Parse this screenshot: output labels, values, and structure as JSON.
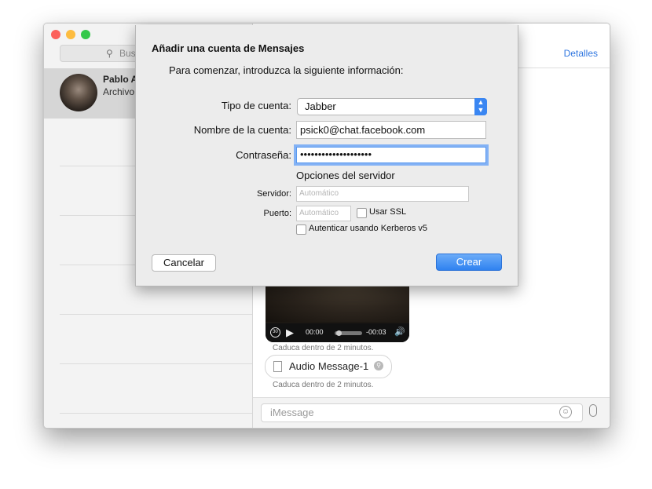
{
  "window": {
    "traffic_lights": [
      "#fc605b",
      "#fdbc40",
      "#34c84a"
    ]
  },
  "sidebar": {
    "search_placeholder": "Bus",
    "conversation": {
      "name": "Pablo A",
      "preview": "Archivo"
    }
  },
  "main": {
    "details_link": "Detalles",
    "video": {
      "skip_label": "30",
      "time_elapsed": "00:00",
      "time_remaining": "-00:03"
    },
    "expires_1": "Caduca dentro de 2 minutos.",
    "audio_message": "Audio Message-1",
    "expires_2": "Caduca dentro de 2 minutos.",
    "message_placeholder": "iMessage"
  },
  "sheet": {
    "title": "Añadir una cuenta de Mensajes",
    "subtitle": "Para comenzar, introduzca la siguiente información:",
    "account_type_label": "Tipo de cuenta:",
    "account_type_value": "Jabber",
    "account_name_label": "Nombre de la cuenta:",
    "account_name_value": "psick0@chat.facebook.com",
    "password_label": "Contraseña:",
    "password_value": "••••••••••••••••••••",
    "server_options_heading": "Opciones del servidor",
    "server_label": "Servidor:",
    "server_placeholder": "Automático",
    "port_label": "Puerto:",
    "port_placeholder": "Automático",
    "ssl_label": "Usar SSL",
    "kerberos_label": "Autenticar usando Kerberos v5",
    "cancel_button": "Cancelar",
    "create_button": "Crear"
  }
}
